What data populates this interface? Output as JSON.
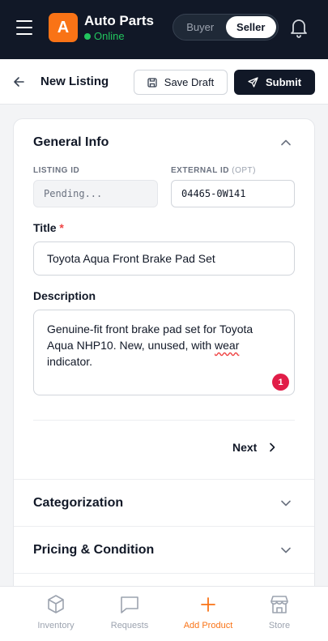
{
  "header": {
    "logo_letter": "A",
    "app_title": "Auto Parts",
    "status": "Online",
    "roles": [
      "Buyer",
      "Seller"
    ],
    "active_role": "Seller"
  },
  "subheader": {
    "title": "New Listing",
    "save_draft": "Save Draft",
    "submit": "Submit"
  },
  "general_info": {
    "title": "General Info",
    "listing_id_label": "LISTING ID",
    "listing_id_value": "Pending...",
    "external_id_label": "EXTERNAL ID",
    "external_id_optional": "(OPT)",
    "external_id_value": "04465-0W141",
    "title_label": "Title",
    "required_mark": "*",
    "title_value": "Toyota Aqua Front Brake Pad Set",
    "description_label": "Description",
    "description_before": "Genuine-fit front brake pad set for Toyota Aqua NHP10. New, unused, with ",
    "description_misspelled": "wear",
    "description_after": " indicator.",
    "description_badge": "1",
    "next": "Next"
  },
  "sections": [
    {
      "title": "Categorization"
    },
    {
      "title": "Pricing & Condition"
    }
  ],
  "bottom_nav": [
    {
      "label": "Inventory",
      "icon": "cube-icon"
    },
    {
      "label": "Requests",
      "icon": "message-icon"
    },
    {
      "label": "Add Product",
      "icon": "plus-icon",
      "active": true
    },
    {
      "label": "Store",
      "icon": "store-icon"
    }
  ],
  "colors": {
    "header_bg": "#111827",
    "accent": "#f97316",
    "online": "#22c55e",
    "required": "#ef4444",
    "badge": "#e11d48"
  }
}
